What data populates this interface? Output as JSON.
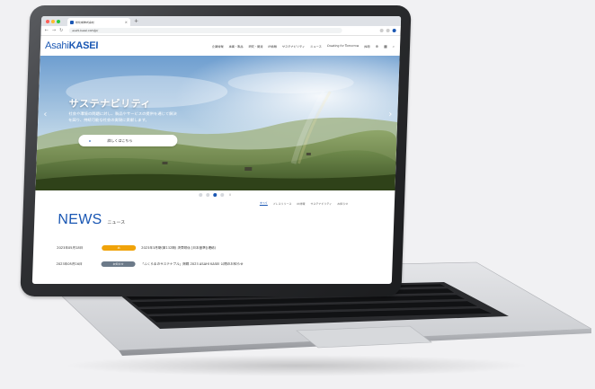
{
  "browser": {
    "tab_title": "旭化成株式会社",
    "url": "asahi-kasei.com/jp/",
    "new_tab": "+",
    "tab_close": "×"
  },
  "site": {
    "logo_part1": "Asahi",
    "logo_part2": "KASEI",
    "nav": [
      "企業情報",
      "事業・製品",
      "研究・開発",
      "IR情報",
      "サステナビリティ",
      "ニュース",
      "Creating for Tomorrow",
      "採用"
    ]
  },
  "hero": {
    "title": "サステナビリティ",
    "subtitle_lines": [
      "社会や環境の問題に対し、製品やサービスの提供を通じて解決",
      "を図り、持続可能な社会の実現に貢献します。"
    ],
    "cta_label": "詳しくはこちら",
    "prev": "‹",
    "next": "›",
    "pause": "II"
  },
  "news": {
    "heading_en": "NEWS",
    "heading_ja": "ニュース",
    "tabs": [
      "すべて",
      "プレスリリース",
      "IR情報",
      "サステナビリティ",
      "お知らせ"
    ],
    "items": [
      {
        "date": "2023年05月18日",
        "badge": "IR",
        "badge_color": "#f0a30a",
        "title": "2023年3月期(第132期) 決算短信 [日本基準](連結)"
      },
      {
        "date": "2023年05月16日",
        "badge": "お知らせ",
        "badge_color": "#6c7a89",
        "title": "「ふくらまのサステナブル」掲載 2023 ASAHI KASEI 公開のお知らせ"
      }
    ]
  },
  "colors": {
    "brand": "#1a57b3"
  }
}
